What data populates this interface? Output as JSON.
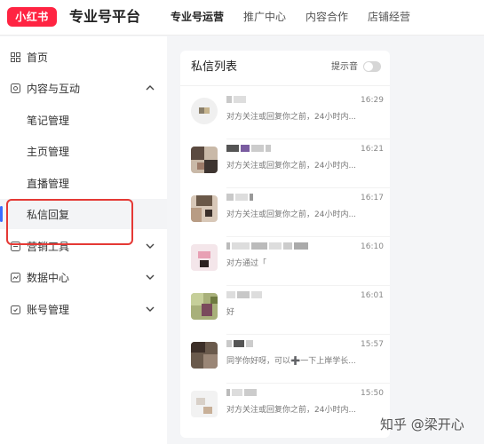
{
  "header": {
    "logo_text": "小红书",
    "platform_title": "专业号平台",
    "nav": [
      {
        "label": "专业号运营",
        "active": true
      },
      {
        "label": "推广中心",
        "active": false
      },
      {
        "label": "内容合作",
        "active": false
      },
      {
        "label": "店铺经营",
        "active": false
      }
    ]
  },
  "sidebar": {
    "items": [
      {
        "label": "首页",
        "icon": "grid-icon"
      },
      {
        "label": "内容与互动",
        "icon": "content-icon",
        "expanded": true
      },
      {
        "label": "笔记管理"
      },
      {
        "label": "主页管理"
      },
      {
        "label": "直播管理"
      },
      {
        "label": "私信回复",
        "selected": true
      },
      {
        "label": "营销工具",
        "icon": "marketing-icon",
        "expanded": false
      },
      {
        "label": "数据中心",
        "icon": "chart-icon",
        "expanded": false
      },
      {
        "label": "账号管理",
        "icon": "account-icon",
        "expanded": false
      }
    ]
  },
  "panel": {
    "title": "私信列表",
    "sound_label": "提示音",
    "sound_on": false
  },
  "messages": [
    {
      "time": "16:29",
      "preview": "对方关注或回复你之前，24小时内..."
    },
    {
      "time": "16:21",
      "preview": "对方关注或回复你之前，24小时内..."
    },
    {
      "time": "16:17",
      "preview": "对方关注或回复你之前，24小时内..."
    },
    {
      "time": "16:10",
      "preview": "对方通过「"
    },
    {
      "time": "16:01",
      "preview": "好"
    },
    {
      "time": "15:57",
      "preview": "同学你好呀，可以➕一下上岸学长..."
    },
    {
      "time": "15:50",
      "preview": "对方关注或回复你之前，24小时内..."
    }
  ],
  "watermark": "知乎 @梁开心",
  "colors": {
    "brand": "#ff2442",
    "accent": "#3a6bff",
    "highlight": "#e53935"
  }
}
